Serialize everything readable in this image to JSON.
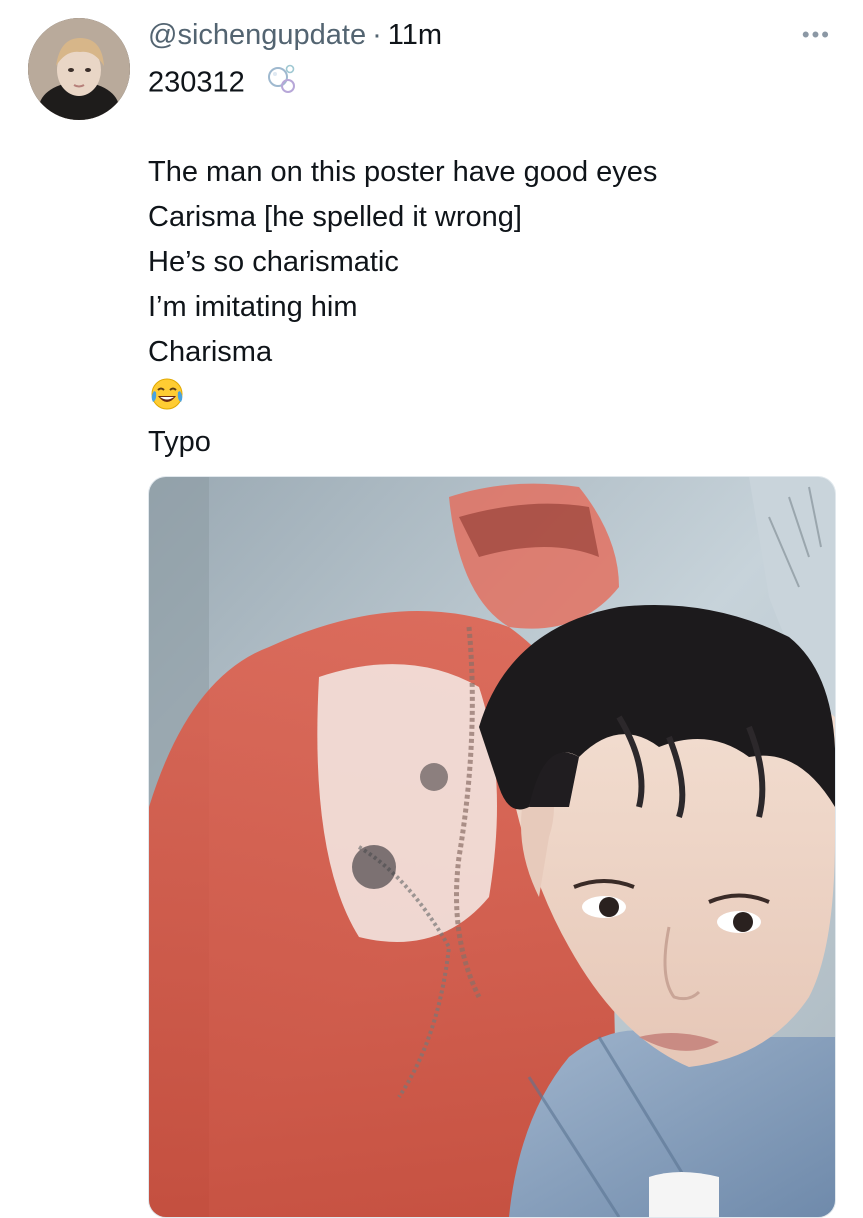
{
  "tweet": {
    "handle": "@sichengupdate",
    "separator": "·",
    "time": "11m",
    "more_icon": "more-dots-icon",
    "avatar_icon": "profile-avatar",
    "lines": [
      "230312",
      "",
      "The man on this poster have good eyes",
      "Carisma [he spelled it wrong]",
      "He’s so charismatic",
      "I’m imitating him",
      "Charisma",
      "",
      "Typo"
    ],
    "date_emoji": "bubbles-icon",
    "laugh_emoji": "tears-of-joy-icon",
    "media_alt": "selfie-photo"
  },
  "colors": {
    "text": "#0f1419",
    "secondary": "#536471",
    "poster_red": "#d9503e",
    "sky": "#b7c6cf",
    "denim": "#8ea6c3"
  }
}
